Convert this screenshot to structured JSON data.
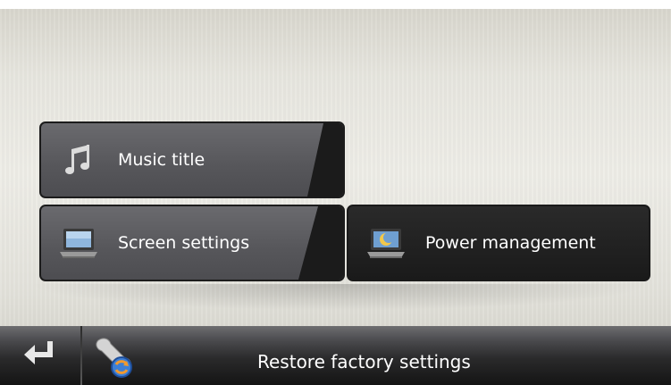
{
  "menu": {
    "tiles": [
      {
        "label": "Music title",
        "icon": "music-note-icon"
      },
      {
        "label": "Screen settings",
        "icon": "laptop-screen-icon"
      },
      {
        "label": "Power management",
        "icon": "moon-screen-icon"
      }
    ]
  },
  "bottom_bar": {
    "back_icon": "back-arrow-icon",
    "action_icon": "wrench-restore-icon",
    "action_label": "Restore factory settings"
  }
}
